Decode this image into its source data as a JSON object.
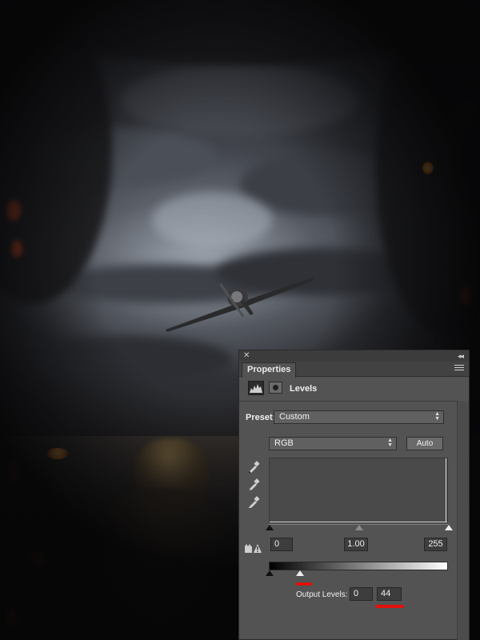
{
  "panel": {
    "tab_title": "Properties",
    "adjustment_label": "Levels",
    "preset_label": "Preset:",
    "preset_value": "Custom",
    "channel_value": "RGB",
    "auto_label": "Auto",
    "input_black": "0",
    "input_gamma": "1.00",
    "input_white": "255",
    "output_label": "Output Levels:",
    "output_black": "0",
    "output_white": "44"
  },
  "icons": [
    "close-icon",
    "collapse-icon",
    "panel-menu-icon",
    "levels-histogram-icon",
    "layer-mask-icon",
    "black-point-eyedropper-icon",
    "gray-point-eyedropper-icon",
    "white-point-eyedropper-icon",
    "clipping-warning-icon"
  ],
  "colors": {
    "panel_bg": "#535353",
    "annotation_red": "#e2100d"
  }
}
